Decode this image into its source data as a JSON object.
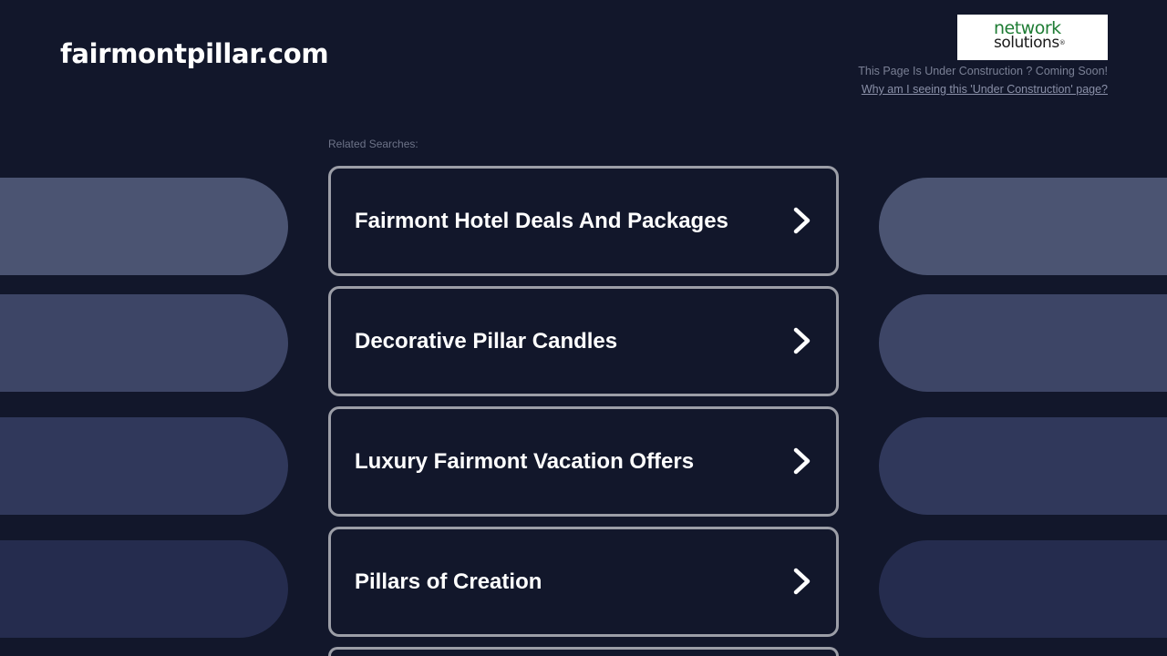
{
  "header": {
    "domain": "fairmontpillar.com",
    "logo_line1": "network",
    "logo_line2": "solutions",
    "logo_reg": "®",
    "under_construction_text": "This Page Is Under Construction ? Coming Soon!",
    "why_link": "Why am I seeing this 'Under Construction' page?"
  },
  "related_label": "Related Searches:",
  "searches": [
    {
      "label": "Fairmont Hotel Deals And Packages"
    },
    {
      "label": "Decorative Pillar Candles"
    },
    {
      "label": "Luxury Fairmont Vacation Offers"
    },
    {
      "label": "Pillars of Creation"
    }
  ],
  "colors": {
    "background": "#12172b",
    "card_border": "#9c9ea7",
    "pill_row1": "#4b5472",
    "pill_row2": "#3d4566",
    "pill_row3": "#30385b",
    "pill_row4": "#252c4e"
  }
}
